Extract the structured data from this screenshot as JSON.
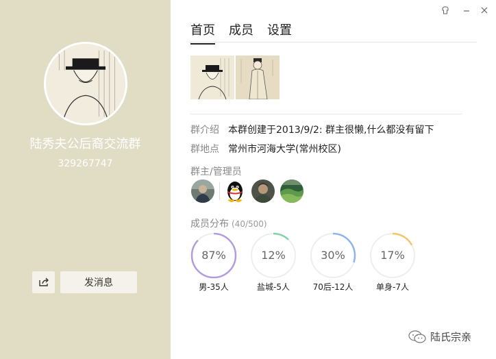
{
  "group": {
    "name": "陆秀夫公后裔交流群",
    "id": "329267747"
  },
  "left_actions": {
    "share_icon": "share-icon",
    "send_message": "发消息"
  },
  "tabs": [
    {
      "label": "首页",
      "active": true
    },
    {
      "label": "成员",
      "active": false
    },
    {
      "label": "设置",
      "active": false
    }
  ],
  "info": {
    "intro_label": "群介绍",
    "intro_value": "本群创建于2013/9/2: 群主很懒,什么都没有留下",
    "location_label": "群地点",
    "location_value": "常州市河海大学(常州校区)"
  },
  "admins": {
    "title": "群主/管理员"
  },
  "distribution": {
    "title": "成员分布",
    "count": "(40/500)",
    "items": [
      {
        "percent_text": "87%",
        "value": 87,
        "label": "男-35人",
        "color": "#b39be0"
      },
      {
        "percent_text": "12%",
        "value": 12,
        "label": "盐城-5人",
        "color": "#7fd3a6"
      },
      {
        "percent_text": "30%",
        "value": 30,
        "label": "70后-12人",
        "color": "#8fb4ea"
      },
      {
        "percent_text": "17%",
        "value": 17,
        "label": "单身-7人",
        "color": "#f2c56b"
      }
    ]
  },
  "watermark": {
    "text": "陆氏宗亲"
  },
  "colors": {
    "left_panel": "#e1dcc4",
    "ring_track": "#eeeeee"
  }
}
